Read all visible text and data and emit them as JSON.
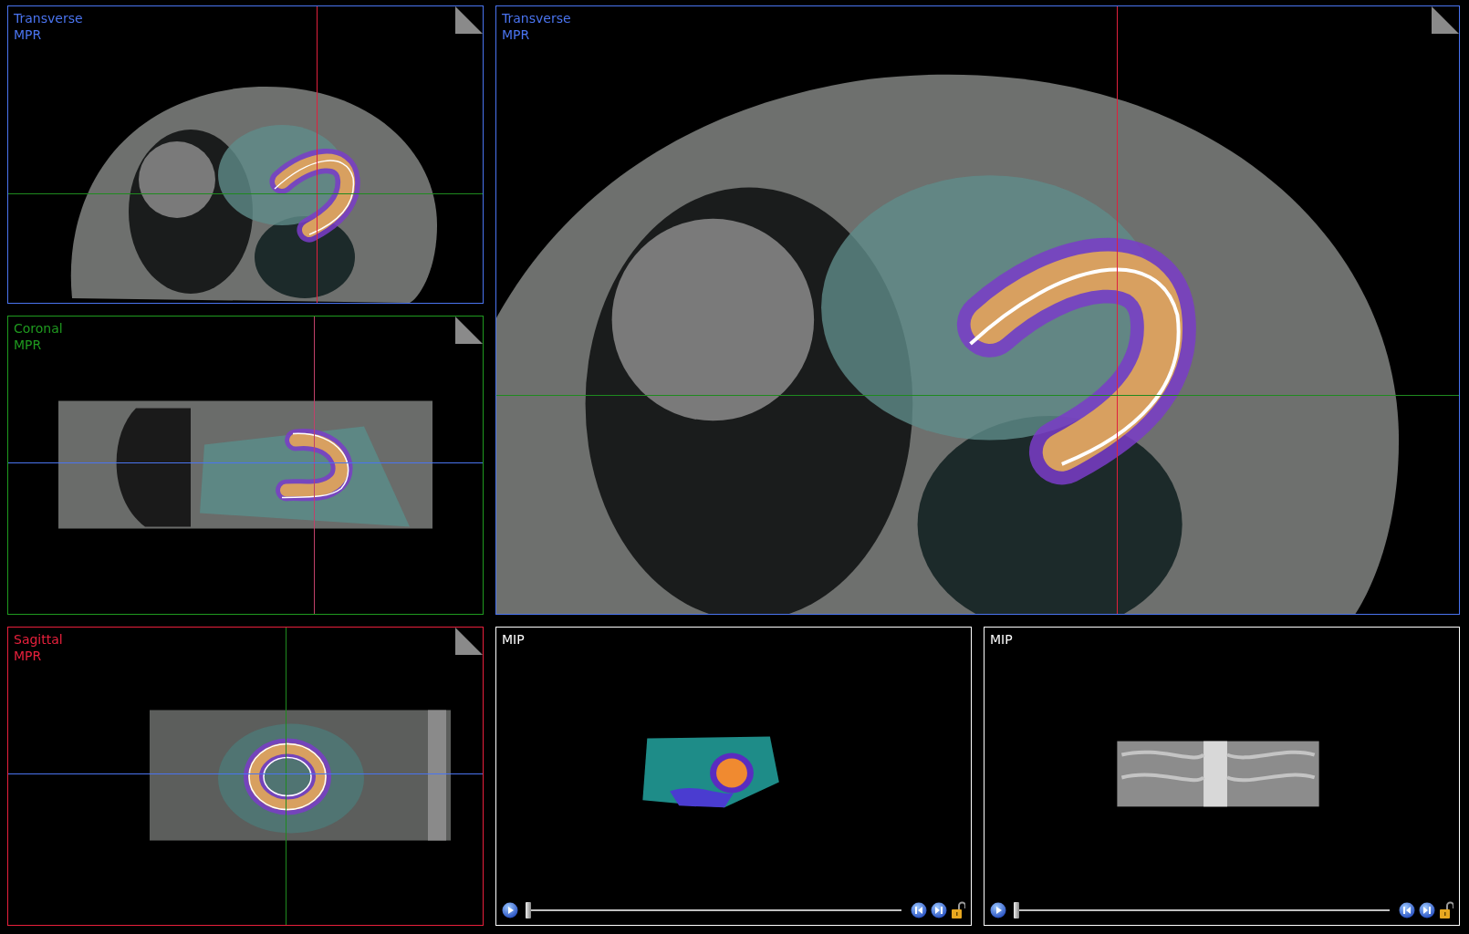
{
  "views": [
    {
      "kind": "axial-mpr",
      "plane": "Transverse",
      "label": "MPR",
      "color": "#4a74f0",
      "crosshairs": [
        {
          "kind": "vertical",
          "color": "#e0203c"
        },
        {
          "kind": "horizontal",
          "color": "#1f8a1f"
        }
      ]
    },
    {
      "kind": "axial-mpr-zoom",
      "plane": "Transverse",
      "label": "MPR",
      "color": "#4a74f0",
      "crosshairs": [
        {
          "kind": "vertical",
          "color": "#e0203c"
        },
        {
          "kind": "horizontal",
          "color": "#1f8a1f"
        }
      ]
    },
    {
      "kind": "coronal-mpr",
      "plane": "Coronal",
      "label": "MPR",
      "color": "#1f9a1f",
      "crosshairs": [
        {
          "kind": "vertical",
          "color": "#c0406a"
        },
        {
          "kind": "horizontal",
          "color": "#4a74f0"
        }
      ]
    },
    {
      "kind": "sagittal-mpr",
      "plane": "Sagittal",
      "label": "MPR",
      "color": "#e8203c",
      "crosshairs": [
        {
          "kind": "vertical",
          "color": "#1f8a1f"
        },
        {
          "kind": "horizontal",
          "color": "#4a74f0"
        }
      ]
    },
    {
      "kind": "pet-mip",
      "label": "MIP",
      "color": "#ffffff",
      "player": {
        "level": 0,
        "locked": false
      }
    },
    {
      "kind": "ct-mip",
      "label": "MIP",
      "color": "#ffffff",
      "player": {
        "level": 0,
        "locked": false
      }
    }
  ]
}
